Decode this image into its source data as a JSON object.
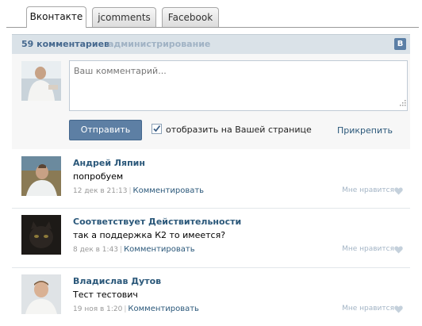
{
  "tabs": [
    "Вконтакте",
    "jcomments",
    "Facebook"
  ],
  "header": {
    "count": "59 комментариев",
    "admin": "администрирование",
    "logo": "B"
  },
  "compose": {
    "placeholder": "Ваш комментарий...",
    "send_label": "Отправить",
    "checkbox_label": "отобразить на Вашей странице",
    "checkbox_checked": true,
    "attach_label": "Прикрепить"
  },
  "comments": [
    {
      "author": "Андрей Ляпин",
      "text": "попробуем",
      "date": "12 дек в 21:13",
      "reply": "Комментировать",
      "like": "Мне нравится"
    },
    {
      "author": "Соответствует Действительности",
      "text": "так а поддержка К2 то имеется?",
      "date": "8 дек в 1:43",
      "reply": "Комментировать",
      "like": "Мне нравится"
    },
    {
      "author": "Владислав Дутов",
      "text": "Тест тестович",
      "date": "19 ноя в 1:20",
      "reply": "Комментировать",
      "like": "Мне нравится"
    }
  ],
  "colors": {
    "link": "#2b587a",
    "header_bg": "#dae2e8",
    "button": "#5d7fa4"
  }
}
